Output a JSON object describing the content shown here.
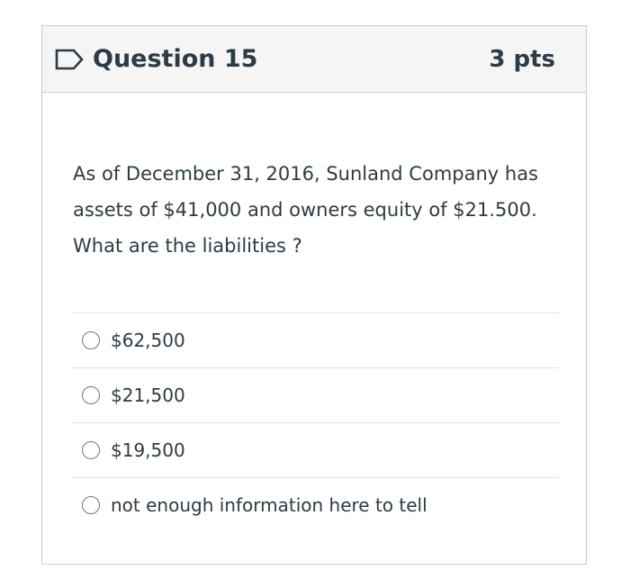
{
  "question": {
    "title": "Question 15",
    "points": "3 pts",
    "flag_icon": "flag-outline-icon",
    "text": "As of December 31, 2016, Sunland Company has assets of $41,000 and owners equity of $21.500. What are the liabilities ?",
    "answers": [
      {
        "label": "$62,500",
        "selected": false
      },
      {
        "label": "$21,500",
        "selected": false
      },
      {
        "label": "$19,500",
        "selected": false
      },
      {
        "label": "not enough information here to tell",
        "selected": false
      }
    ]
  },
  "colors": {
    "header_bg": "#f5f5f5",
    "border": "#c7cdd1",
    "text": "#2d3b45",
    "flag": "#2d3b45"
  }
}
